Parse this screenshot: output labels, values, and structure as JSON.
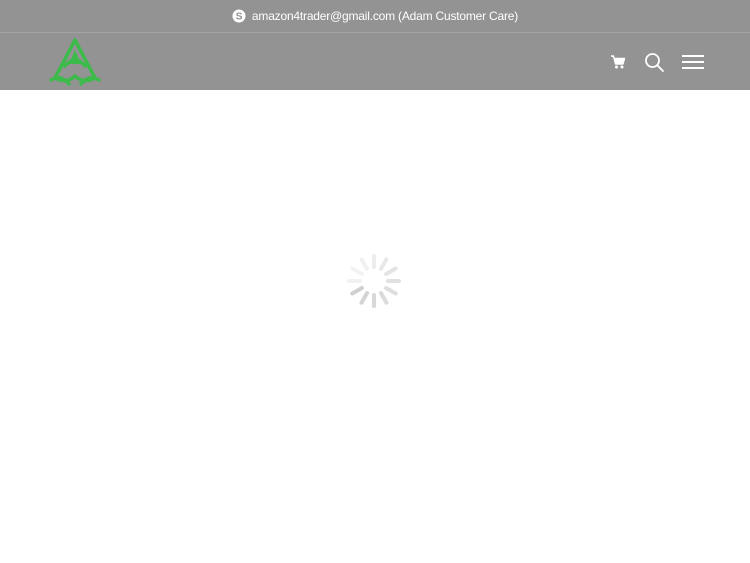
{
  "topbar": {
    "skype_icon": "skype-icon",
    "contact_text": "amazon4trader@gmail.com (Adam Customer Care)"
  },
  "header": {
    "logo_icon": "brand-logo",
    "icons": [
      "cart-icon",
      "search-icon",
      "hamburger-menu-icon"
    ]
  },
  "main": {
    "loading_icon": "loading-spinner-icon"
  },
  "colors": {
    "header_bg": "#939393",
    "logo_green": "#3dbb4a",
    "spinner_gray": "#e6e6e6",
    "text": "#ffffff"
  }
}
